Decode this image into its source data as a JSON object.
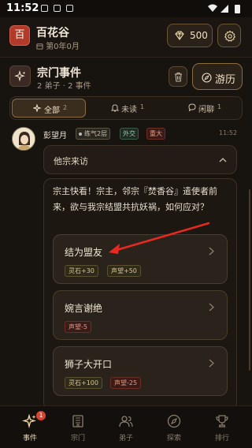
{
  "status_bar": {
    "time": "11:52"
  },
  "header": {
    "logo_char": "百",
    "sect_name": "百花谷",
    "sect_time": "第0年0月",
    "spirit_stone": "500"
  },
  "events": {
    "title": "宗门事件",
    "subtitle": "2 弟子 · 2 事件",
    "travel_label": "游历"
  },
  "tabs": [
    {
      "label": "全部",
      "count": "2"
    },
    {
      "label": "未读",
      "count": "1"
    },
    {
      "label": "闲聊",
      "count": "1"
    }
  ],
  "message": {
    "name": "彭望月",
    "realm": "练气2层",
    "type": "外交",
    "level": "重大",
    "time": "11:52",
    "event_title": "他宗来访",
    "body": "宗主快看！宗主，邻宗『焚香谷』遣使者前来，欲与我宗结盟共抗妖祸，如何应对？"
  },
  "choices": [
    {
      "label": "结为盟友",
      "effects": [
        {
          "text": "灵石+30",
          "kind": "pos"
        },
        {
          "text": "声望+50",
          "kind": "pos"
        }
      ]
    },
    {
      "label": "婉言谢绝",
      "effects": [
        {
          "text": "声望-5",
          "kind": "neg"
        }
      ]
    },
    {
      "label": "狮子大开口",
      "effects": [
        {
          "text": "灵石+100",
          "kind": "pos"
        },
        {
          "text": "声望-25",
          "kind": "neg"
        }
      ]
    }
  ],
  "bottom_nav": [
    {
      "label": "事件",
      "badge": "1"
    },
    {
      "label": "宗门"
    },
    {
      "label": "弟子"
    },
    {
      "label": "探索"
    },
    {
      "label": "排行"
    }
  ],
  "colors": {
    "accent_gold": "#8a6d3e",
    "arrow_red": "#e8291f",
    "badge_red": "#d64531"
  }
}
